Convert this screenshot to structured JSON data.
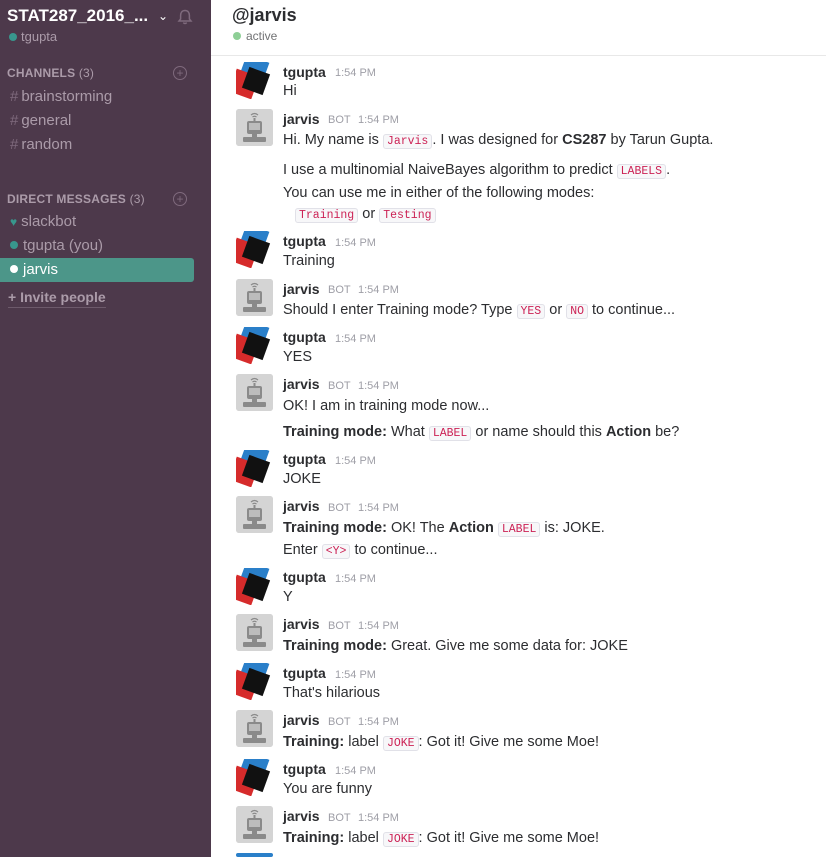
{
  "sidebar": {
    "team_name": "STAT287_2016_...",
    "team_caret": "⌄",
    "current_user": "tgupta",
    "channels_header": "CHANNELS",
    "channels_count": "(3)",
    "channels": [
      "brainstorming",
      "general",
      "random"
    ],
    "dm_header": "DIRECT MESSAGES",
    "dm_count": "(3)",
    "dms": [
      "slackbot",
      "tgupta (you)",
      "jarvis"
    ],
    "invite_label": "Invite people"
  },
  "header": {
    "name": "@jarvis",
    "status": "active"
  },
  "colors": {
    "sidebar_bg": "#4d394b",
    "active_item": "#4c9689",
    "presence": "#38978d"
  },
  "messages": {
    "m1": {
      "author": "tgupta",
      "time": "1:54 PM",
      "text": "Hi"
    },
    "m2": {
      "author": "jarvis",
      "badge": "BOT",
      "time": "1:54 PM",
      "l1a": "Hi. My name is",
      "l1code": "Jarvis",
      "l1b": ". I was designed for",
      "l1bold": "CS287",
      "l1c": "by Tarun Gupta.",
      "l2a": "I use a multinomial NaiveBayes algorithm to predict",
      "l2code": "LABELS",
      "l2b": ".",
      "l3": "You can use me in either of the following modes:",
      "l4code1": "Training",
      "l4or": "or",
      "l4code2": "Testing"
    },
    "m3": {
      "author": "tgupta",
      "time": "1:54 PM",
      "text": "Training"
    },
    "m4": {
      "author": "jarvis",
      "badge": "BOT",
      "time": "1:54 PM",
      "a": "Should I enter Training mode? Type",
      "code1": "YES",
      "or": "or",
      "code2": "NO",
      "b": "to continue..."
    },
    "m5": {
      "author": "tgupta",
      "time": "1:54 PM",
      "text": "YES"
    },
    "m6": {
      "author": "jarvis",
      "badge": "BOT",
      "time": "1:54 PM",
      "l1": "OK! I am in training mode now...",
      "l2bold": "Training mode:",
      "l2a": "What",
      "l2code": "LABEL",
      "l2b": "or name should this",
      "l2bold2": "Action",
      "l2c": "be?"
    },
    "m7": {
      "author": "tgupta",
      "time": "1:54 PM",
      "text": "JOKE"
    },
    "m8": {
      "author": "jarvis",
      "badge": "BOT",
      "time": "1:54 PM",
      "l1bold": "Training mode:",
      "l1a": "OK! The",
      "l1bold2": "Action",
      "l1code": "LABEL",
      "l1b": "is: JOKE.",
      "l2a": "Enter",
      "l2code": "<Y>",
      "l2b": "to continue..."
    },
    "m9": {
      "author": "tgupta",
      "time": "1:54 PM",
      "text": "Y"
    },
    "m10": {
      "author": "jarvis",
      "badge": "BOT",
      "time": "1:54 PM",
      "bold": "Training mode:",
      "a": "Great. Give me some data for: JOKE"
    },
    "m11": {
      "author": "tgupta",
      "time": "1:54 PM",
      "text": "That's hilarious"
    },
    "m12": {
      "author": "jarvis",
      "badge": "BOT",
      "time": "1:54 PM",
      "bold": "Training:",
      "a": "label",
      "code": "JOKE",
      "b": ": Got it! Give me some Moe!"
    },
    "m13": {
      "author": "tgupta",
      "time": "1:54 PM",
      "text": "You are funny"
    },
    "m14": {
      "author": "jarvis",
      "badge": "BOT",
      "time": "1:54 PM",
      "bold": "Training:",
      "a": "label",
      "code": "JOKE",
      "b": ": Got it! Give me some Moe!"
    }
  }
}
